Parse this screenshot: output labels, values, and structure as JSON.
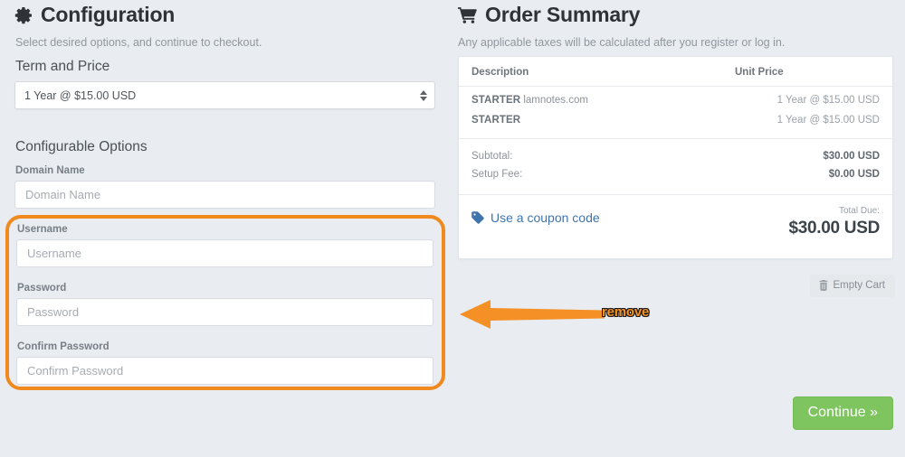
{
  "configuration": {
    "icon": "gear-icon",
    "title": "Configuration",
    "subtitle": "Select desired options, and continue to checkout.",
    "term_section_title": "Term and Price",
    "term_select_value": "1 Year @ $15.00 USD",
    "options_section_title": "Configurable Options",
    "fields": [
      {
        "label": "Domain Name",
        "placeholder": "Domain Name",
        "value": ""
      },
      {
        "label": "Username",
        "placeholder": "Username",
        "value": ""
      },
      {
        "label": "Password",
        "placeholder": "Password",
        "value": ""
      },
      {
        "label": "Confirm Password",
        "placeholder": "Confirm Password",
        "value": ""
      }
    ]
  },
  "order_summary": {
    "icon": "shopping-cart-icon",
    "title": "Order Summary",
    "subtitle": "Any applicable taxes will be calculated after you register or log in.",
    "columns": {
      "description": "Description",
      "unit_price": "Unit Price"
    },
    "items": [
      {
        "plan": "STARTER",
        "domain": "lamnotes.com",
        "unit_price": "1 Year @ $15.00 USD"
      },
      {
        "plan": "STARTER",
        "domain": "",
        "unit_price": "1 Year @ $15.00 USD"
      }
    ],
    "totals": [
      {
        "label": "Subtotal:",
        "value": "$30.00 USD"
      },
      {
        "label": "Setup Fee:",
        "value": "$0.00 USD"
      }
    ],
    "coupon": {
      "icon": "tag-icon",
      "label": "Use a coupon code"
    },
    "total_due": {
      "label": "Total Due:",
      "amount": "$30.00 USD"
    },
    "empty_cart": {
      "icon": "trash-icon",
      "label": "Empty Cart"
    },
    "continue": {
      "label": "Continue »"
    }
  },
  "annotations": {
    "remove_label": "remove",
    "highlight_color": "#f08a1e",
    "arrow_color": "#f49025"
  },
  "colors": {
    "page_background": "#e9edf1",
    "accent_green": "#7ec45f",
    "link_blue": "#3f74ac",
    "highlight_orange": "#f08a1e"
  }
}
